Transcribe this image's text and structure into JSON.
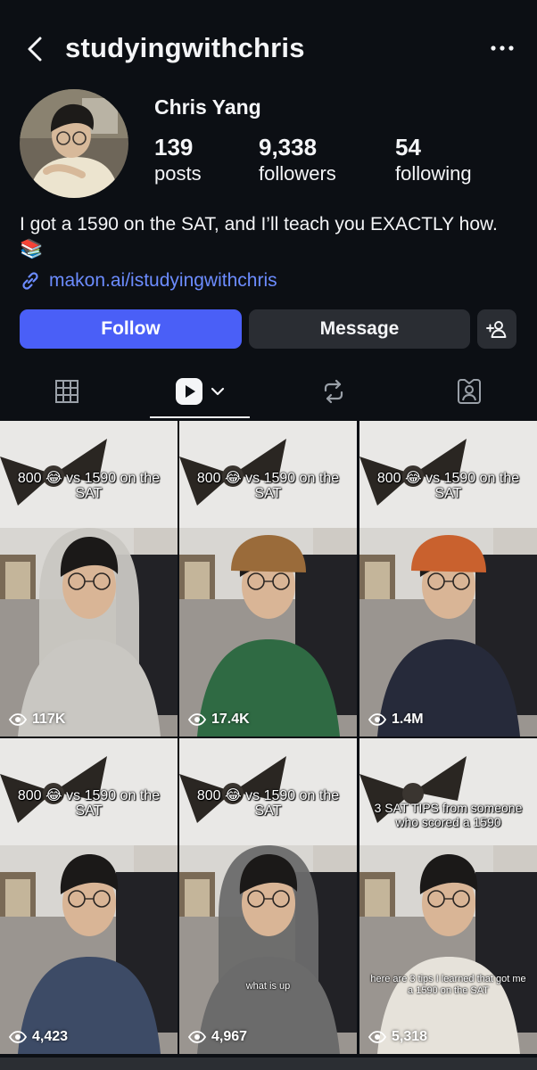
{
  "header": {
    "username": "studyingwithchris"
  },
  "profile": {
    "display_name": "Chris Yang",
    "stats": {
      "posts": {
        "value": "139",
        "label": "posts"
      },
      "followers": {
        "value": "9,338",
        "label": "followers"
      },
      "following": {
        "value": "54",
        "label": "following"
      }
    },
    "bio": "I got a 1590 on the SAT, and I’ll teach you EXACTLY how. 📚",
    "link": "makon.ai/istudyingwithchris"
  },
  "actions": {
    "follow": "Follow",
    "message": "Message"
  },
  "tabs": [
    {
      "name": "grid-icon",
      "selected": false
    },
    {
      "name": "reels-icon",
      "selected": true
    },
    {
      "name": "reposts-icon",
      "selected": false
    },
    {
      "name": "tagged-icon",
      "selected": false
    }
  ],
  "reels": [
    {
      "caption": "800 😂 vs 1590 on the SAT",
      "subtitle": "",
      "views": "117K",
      "shirt": "#c9c7c2",
      "hat": ""
    },
    {
      "caption": "800 😂 vs 1590 on the SAT",
      "subtitle": "",
      "views": "17.4K",
      "shirt": "#2f6a43",
      "hat": "#9a6b3a"
    },
    {
      "caption": "800 😂 vs 1590 on the SAT",
      "subtitle": "",
      "views": "1.4M",
      "shirt": "#262a3a",
      "hat": "#c9612e"
    },
    {
      "caption": "800 😂 vs 1590 on the SAT",
      "subtitle": "",
      "views": "4,423",
      "shirt": "#3d4b66",
      "hat": ""
    },
    {
      "caption": "800 😂 vs 1590 on the SAT",
      "subtitle": "what is up",
      "views": "4,967",
      "shirt": "#6b6b6b",
      "hat": ""
    },
    {
      "caption": "3 SAT TIPS from someone who scored a 1590",
      "subtitle": "here are 3 tips I learned that got me a 1590 on the SAT",
      "views": "5,318",
      "shirt": "#e6e2da",
      "hat": ""
    }
  ],
  "colors": {
    "background": "#0c0f14",
    "follow": "#4a5ff7",
    "secondary_button": "#2a2d33",
    "link": "#6c8cff"
  }
}
